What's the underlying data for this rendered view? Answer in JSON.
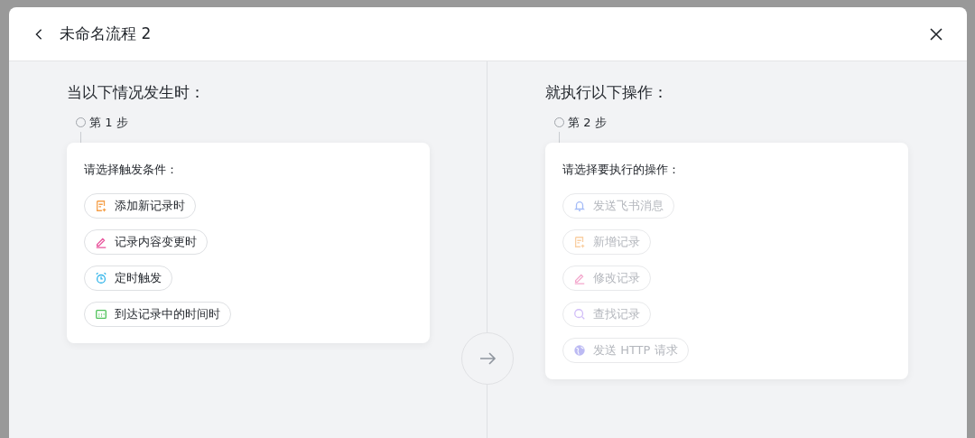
{
  "dialog": {
    "title": "未命名流程 2"
  },
  "trigger": {
    "heading": "当以下情况发生时：",
    "step": "第 1 步",
    "prompt": "请选择触发条件：",
    "options": [
      {
        "label": "添加新记录时",
        "kind": "record-add",
        "disabled": false
      },
      {
        "label": "记录内容变更时",
        "kind": "edit",
        "disabled": false
      },
      {
        "label": "定时触发",
        "kind": "alarm",
        "disabled": false
      },
      {
        "label": "到达记录中的时间时",
        "kind": "calendar",
        "disabled": false
      }
    ]
  },
  "action": {
    "heading": "就执行以下操作：",
    "step": "第 2 步",
    "prompt": "请选择要执行的操作：",
    "options": [
      {
        "label": "发送飞书消息",
        "kind": "bell",
        "disabled": true
      },
      {
        "label": "新增记录",
        "kind": "record-add",
        "disabled": true
      },
      {
        "label": "修改记录",
        "kind": "edit",
        "disabled": true
      },
      {
        "label": "查找记录",
        "kind": "search",
        "disabled": true
      },
      {
        "label": "发送 HTTP 请求",
        "kind": "globe",
        "disabled": true
      }
    ]
  }
}
